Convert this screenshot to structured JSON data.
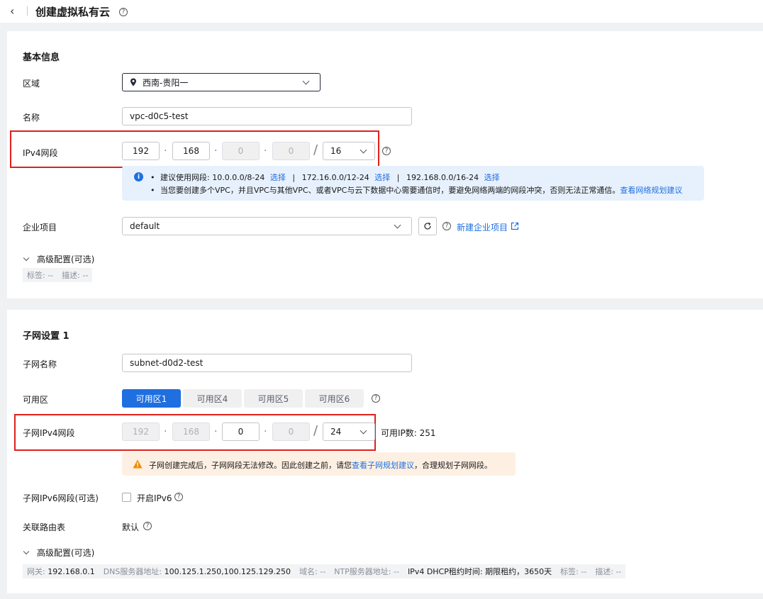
{
  "header": {
    "title": "创建虚拟私有云",
    "back_icon": "‹",
    "help": "?"
  },
  "basic": {
    "title": "基本信息",
    "region": {
      "label": "区域",
      "value": "西南-贵阳一"
    },
    "name": {
      "label": "名称",
      "value": "vpc-d0c5-test"
    },
    "ipv4": {
      "label": "IPv4网段",
      "o1": "192",
      "o2": "168",
      "o3": "0",
      "o4": "0",
      "dot": "·",
      "slash": "/",
      "mask": "16"
    },
    "tips": {
      "line1_prefix": "建议使用网段: 10.0.0.0/8-24",
      "select": "选择",
      "pipe": "|",
      "seg2": "172.16.0.0/12-24",
      "seg3": "192.168.0.0/16-24",
      "line2": "当您要创建多个VPC，并且VPC与其他VPC、或者VPC与云下数据中心需要通信时，要避免网络两端的网段冲突，否则无法正常通信。",
      "line2_link": "查看网络规划建议",
      "bullet": "•"
    },
    "enterprise": {
      "label": "企业项目",
      "value": "default",
      "new_link": "新建企业项目"
    },
    "advanced": {
      "label": "高级配置(可选)",
      "tags": "标签: --",
      "desc": "描述: --"
    }
  },
  "subnet": {
    "title": "子网设置 1",
    "name": {
      "label": "子网名称",
      "value": "subnet-d0d2-test"
    },
    "az": {
      "label": "可用区",
      "tabs": [
        "可用区1",
        "可用区4",
        "可用区5",
        "可用区6"
      ]
    },
    "ipv4": {
      "label": "子网IPv4网段",
      "o1": "192",
      "o2": "168",
      "o3": "0",
      "o4": "0",
      "mask": "24",
      "available": "可用IP数: 251"
    },
    "warning": {
      "text1": "子网创建完成后，子网网段无法修改。因此创建之前，请您",
      "link": "查看子网规划建议",
      "text2": "，合理规划子网网段。"
    },
    "ipv6": {
      "label": "子网IPv6网段(可选)",
      "checkbox": "开启IPv6"
    },
    "route": {
      "label": "关联路由表",
      "value": "默认"
    },
    "advanced": {
      "label": "高级配置(可选)",
      "gateway_k": "网关:",
      "gateway_v": "192.168.0.1",
      "dns_k": "DNS服务器地址:",
      "dns_v": "100.125.1.250,100.125.129.250",
      "domain": "域名: --",
      "ntp": "NTP服务器地址: --",
      "dhcp_k": "IPv4 DHCP租约时间:",
      "dhcp_v": "期限租约，3650天",
      "tags": "标签: --",
      "desc": "描述: --"
    }
  },
  "colors": {
    "accent": "#1f6fe0",
    "highlight": "#e0201b",
    "warning": "#f08a00"
  }
}
